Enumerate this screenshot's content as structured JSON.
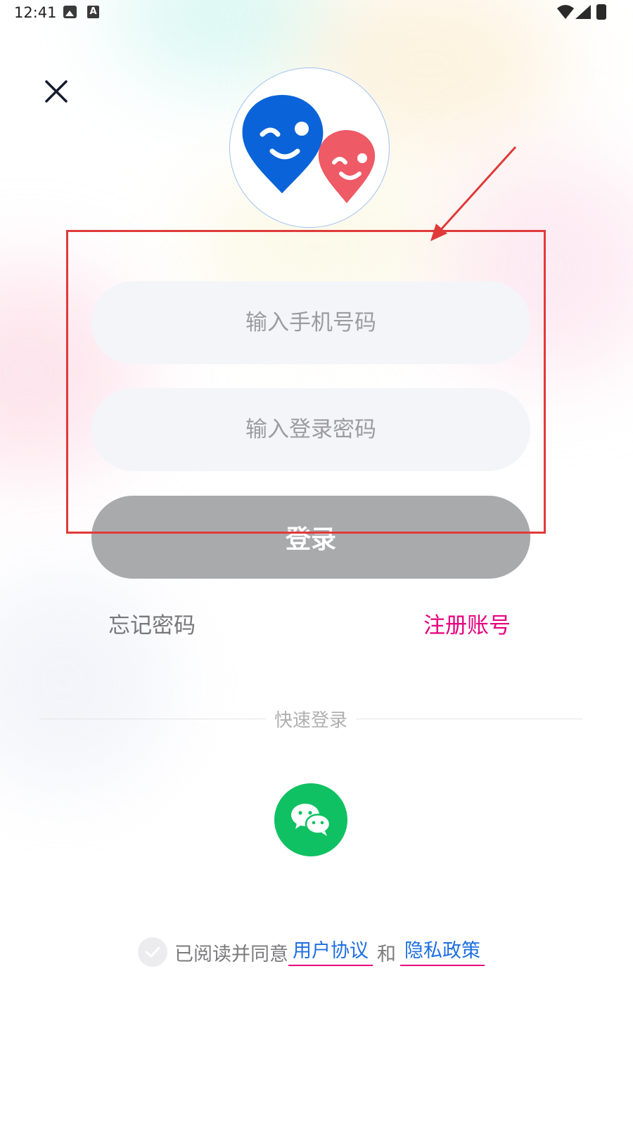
{
  "status_bar": {
    "time": "12:41"
  },
  "login_form": {
    "phone_placeholder": "输入手机号码",
    "password_placeholder": "输入登录密码",
    "login_button": "登录"
  },
  "links": {
    "forgot_password": "忘记密码",
    "register": "注册账号"
  },
  "quick_login": {
    "label": "快速登录"
  },
  "agreement": {
    "prefix": "已阅读并同意",
    "user_agreement": "用户协议",
    "and": "和",
    "privacy_policy": "隐私政策"
  },
  "colors": {
    "accent_pink": "#e6007e",
    "link_blue": "#1f6fe0",
    "wechat_green": "#0fc162",
    "login_button_disabled": "#a9aaac",
    "annotation_red": "#e03a3a",
    "logo_blue": "#0a63d8",
    "logo_red": "#ee5a66"
  },
  "icons": [
    "close-icon",
    "wechat-icon",
    "check-icon",
    "wifi-icon",
    "signal-icon",
    "battery-icon",
    "image-icon",
    "a-icon",
    "app-logo"
  ]
}
